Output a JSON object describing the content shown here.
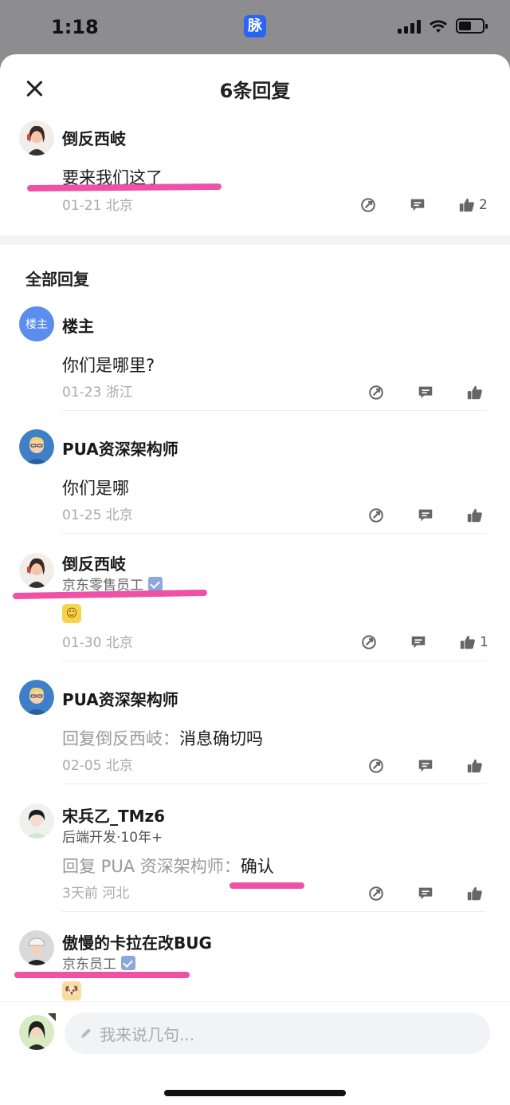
{
  "status_bar": {
    "time": "1:18",
    "app_badge": "脉"
  },
  "sheet": {
    "title": "6条回复"
  },
  "main_comment": {
    "author": "倒反西岐",
    "text": "要来我们这了",
    "meta": "01-21 北京",
    "likes": "2"
  },
  "section_title": "全部回复",
  "replies": [
    {
      "avatar_text": "楼主",
      "author": "楼主",
      "text": "你们是哪里?",
      "meta": "01-23 浙江",
      "likes": ""
    },
    {
      "author": "PUA资深架构师",
      "text": "你们是哪",
      "meta": "01-25 北京",
      "likes": ""
    },
    {
      "author": "倒反西岐",
      "subtitle": "京东零售员工",
      "meta": "01-30 北京",
      "likes": "1"
    },
    {
      "author": "PUA资深架构师",
      "reply_prefix": "回复倒反西岐：",
      "text": "消息确切吗",
      "meta": "02-05 北京",
      "likes": ""
    },
    {
      "author": "宋兵乙_TMz6",
      "subtitle": "后端开发·10年+",
      "reply_prefix": "回复 PUA 资深架构师：",
      "text": "确认",
      "meta": "3天前 河北",
      "likes": ""
    },
    {
      "author": "傲慢的卡拉在改BUG",
      "subtitle": "京东员工"
    }
  ],
  "input": {
    "placeholder": "我来说几句..."
  },
  "icons": [
    "close-icon",
    "share-icon",
    "comment-icon",
    "like-icon",
    "verified-icon",
    "pencil-icon"
  ],
  "colors": {
    "accent": "#2a64f6",
    "highlight": "#ec3e9c",
    "verify": "#8ba8dd"
  }
}
